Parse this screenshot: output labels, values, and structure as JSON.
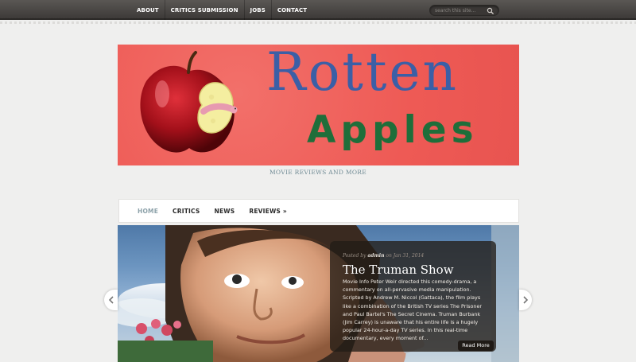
{
  "topnav": {
    "items": [
      "ABOUT",
      "CRITICS SUBMISSION",
      "JOBS",
      "CONTACT"
    ],
    "search_placeholder": "search this site..."
  },
  "banner": {
    "title": "Rotten",
    "subtitle": "Apples"
  },
  "tagline": "MOVIE REVIEWS AND MORE",
  "mainnav": {
    "items": [
      "HOME",
      "CRITICS",
      "NEWS",
      "REVIEWS »"
    ]
  },
  "slide": {
    "meta_prefix": "Posted by",
    "meta_author": "admin",
    "meta_date": "on Jan 31, 2014",
    "title": "The Truman Show",
    "excerpt": "Movie Info Peter Weir directed this comedy-drama, a commentary on all-pervasive media manipulation. Scripted by Andrew M. Niccol (Gattaca), the film plays like a combination of the British TV series The Prisoner and Paul Bartel's The Secret Cinema. Truman Burbank (Jim Carrey) is unaware that his entire life is a hugely popular 24-hour-a-day TV series. In this real-time documentary, every moment of...",
    "read_more": "Read More"
  },
  "colors": {
    "banner_bg": "#ee5a55",
    "title_blue": "#3b5fa6",
    "subtitle_green": "#1f6e3a",
    "active_nav": "#8da2aa"
  }
}
